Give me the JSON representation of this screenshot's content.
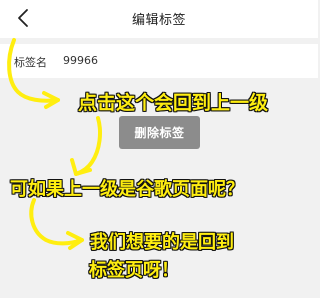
{
  "navbar": {
    "title": "编辑标签",
    "back_icon": "chevron-left-icon"
  },
  "tag": {
    "label": "标签名",
    "value": "99966"
  },
  "actions": {
    "delete_label": "删除标签"
  },
  "annotations": {
    "note1": "点击这个会回到上一级",
    "note2": "可如果上一级是谷歌页面呢？",
    "note3_line1": "我们想要的是回到",
    "note3_line2": "标签页呀！"
  },
  "colors": {
    "background": "#f1f1f1",
    "button": "#8c8c8c",
    "annotation": "#ffee10"
  }
}
